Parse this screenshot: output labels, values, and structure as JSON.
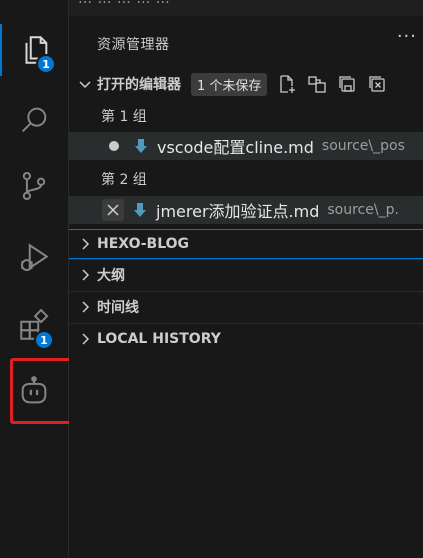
{
  "topbar": {
    "ghost_text": "…  …   …    …    …"
  },
  "activity_bar": {
    "explorer_badge": "1",
    "extensions_badge": "1"
  },
  "explorer": {
    "title": "资源管理器",
    "more": "···",
    "open_editors": {
      "title": "打开的编辑器",
      "unsaved_badge": "1 个未保存",
      "groups": [
        {
          "label": "第 1 组",
          "file": {
            "name": "vscode配置cline.md",
            "path": "source\\_pos"
          }
        },
        {
          "label": "第 2 组",
          "file": {
            "name": "jmerer添加验证点.md",
            "path": "source\\_p."
          }
        }
      ]
    },
    "sections": [
      "HEXO-BLOG",
      "大纲",
      "时间线",
      "LOCAL HISTORY"
    ]
  },
  "colors": {
    "accent": "#0078d4",
    "highlight": "#e02020",
    "md_icon": "#519aba"
  }
}
